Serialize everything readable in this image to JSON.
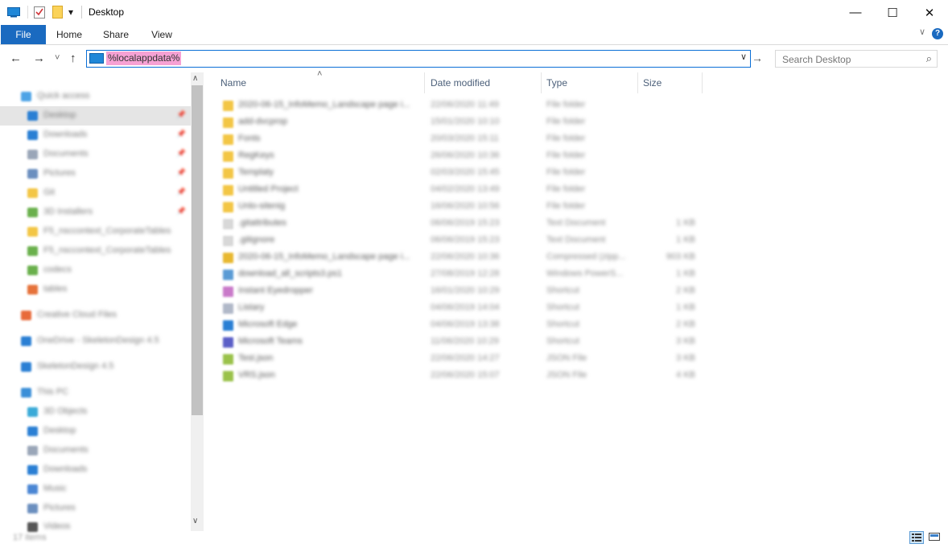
{
  "window": {
    "title": "Desktop",
    "minimize_icon": "—",
    "maximize_icon": "☐",
    "close_icon": "✕"
  },
  "quick_access_toolbar": {
    "dropdown_icon": "▾"
  },
  "ribbon": {
    "tabs": [
      "File",
      "Home",
      "Share",
      "View"
    ],
    "collapse_icon": "∨",
    "help_icon": "?"
  },
  "navigation": {
    "back_icon": "←",
    "forward_icon": "→",
    "recent_icon": "˅",
    "up_icon": "↑",
    "address_value": "%localappdata%",
    "address_dropdown_icon": "∨",
    "go_icon": "→",
    "search_placeholder": "Search Desktop",
    "search_icon": "⌕"
  },
  "nav_pane": {
    "items": [
      {
        "label": "Quick access",
        "color": "#4da3e6"
      },
      {
        "label": "Desktop",
        "color": "#2a7fd4",
        "pin": "📌"
      },
      {
        "label": "Downloads",
        "color": "#2a7fd4",
        "pin": "📌"
      },
      {
        "label": "Documents",
        "color": "#9aa6b8",
        "pin": "📌"
      },
      {
        "label": "Pictures",
        "color": "#6b8fbf",
        "pin": "📌"
      },
      {
        "label": "Git",
        "color": "#f3c645",
        "pin": "📌"
      },
      {
        "label": "3D Installers",
        "color": "#6ab04c",
        "pin": "📌"
      },
      {
        "label": "F5_nsccontext_CorporateTables",
        "color": "#f3c645"
      },
      {
        "label": "F5_nsccontext_CorporateTables",
        "color": "#6ab04c"
      },
      {
        "label": "codecs",
        "color": "#6ab04c"
      },
      {
        "label": "tables",
        "color": "#e6723a"
      },
      {
        "label": "Creative Cloud Files",
        "color": "#e86a3a"
      },
      {
        "label": "OneDrive - SkeletonDesign 4.5",
        "color": "#2a7fd4"
      },
      {
        "label": "SkeletonDesign 4.5",
        "color": "#2a7fd4"
      },
      {
        "label": "This PC",
        "color": "#3a8fd8"
      },
      {
        "label": "3D Objects",
        "color": "#3aaad8"
      },
      {
        "label": "Desktop",
        "color": "#2a7fd4"
      },
      {
        "label": "Documents",
        "color": "#9aa6b8"
      },
      {
        "label": "Downloads",
        "color": "#2a7fd4"
      },
      {
        "label": "Music",
        "color": "#4a86d4"
      },
      {
        "label": "Pictures",
        "color": "#6b8fbf"
      },
      {
        "label": "Videos",
        "color": "#555555"
      }
    ],
    "scroll_up_icon": "∧",
    "scroll_down_icon": "∨"
  },
  "file_list": {
    "columns": [
      "Name",
      "Date modified",
      "Type",
      "Size"
    ],
    "sort_icon": "˄",
    "rows": [
      {
        "name": "2020-06-15_InfoMemo_Landscape page i...",
        "date": "22/06/2020 11:49",
        "type": "File folder",
        "size": "",
        "color": "#f3c645"
      },
      {
        "name": "add-dvcprop",
        "date": "15/01/2020 10:10",
        "type": "File folder",
        "size": "",
        "color": "#f3c645"
      },
      {
        "name": "Fonts",
        "date": "20/03/2020 15:11",
        "type": "File folder",
        "size": "",
        "color": "#f3c645"
      },
      {
        "name": "RegKeys",
        "date": "26/06/2020 10:36",
        "type": "File folder",
        "size": "",
        "color": "#f3c645"
      },
      {
        "name": "Templaty",
        "date": "02/03/2020 15:45",
        "type": "File folder",
        "size": "",
        "color": "#f3c645"
      },
      {
        "name": "Untitled Project",
        "date": "04/02/2020 13:49",
        "type": "File folder",
        "size": "",
        "color": "#f3c645"
      },
      {
        "name": "Unlo-sitenig",
        "date": "16/06/2020 10:56",
        "type": "File folder",
        "size": "",
        "color": "#f3c645"
      },
      {
        "name": ".gitattributes",
        "date": "06/06/2019 15:23",
        "type": "Text Document",
        "size": "1 KB",
        "color": "#d8d8d8"
      },
      {
        "name": ".gitignore",
        "date": "06/06/2019 15:23",
        "type": "Text Document",
        "size": "1 KB",
        "color": "#d8d8d8"
      },
      {
        "name": "2020-06-15_InfoMemo_Landscape page i...",
        "date": "22/06/2020 10:36",
        "type": "Compressed (zipp...",
        "size": "903 KB",
        "color": "#e8b830"
      },
      {
        "name": "download_all_scripts3.ps1",
        "date": "27/08/2019 12:28",
        "type": "Windows PowerS...",
        "size": "1 KB",
        "color": "#5a9bd5"
      },
      {
        "name": "Instant Eyedropper",
        "date": "16/01/2020 10:29",
        "type": "Shortcut",
        "size": "2 KB",
        "color": "#c97ac9"
      },
      {
        "name": "Listary",
        "date": "04/06/2019 14:04",
        "type": "Shortcut",
        "size": "1 KB",
        "color": "#b0b8c8"
      },
      {
        "name": "Microsoft Edge",
        "date": "04/06/2019 13:38",
        "type": "Shortcut",
        "size": "2 KB",
        "color": "#2a7fd4"
      },
      {
        "name": "Microsoft Teams",
        "date": "11/06/2020 10:29",
        "type": "Shortcut",
        "size": "3 KB",
        "color": "#5b5fc7"
      },
      {
        "name": "Test.json",
        "date": "22/06/2020 14:27",
        "type": "JSON File",
        "size": "3 KB",
        "color": "#9ac24a"
      },
      {
        "name": "VRS.json",
        "date": "22/06/2020 15:07",
        "type": "JSON File",
        "size": "4 KB",
        "color": "#9ac24a"
      }
    ]
  },
  "status_bar": {
    "text": "17 items"
  },
  "colors": {
    "accent": "#1a6ac0",
    "address_border": "#0a6fd6",
    "address_highlight": "#f6a1d4"
  }
}
